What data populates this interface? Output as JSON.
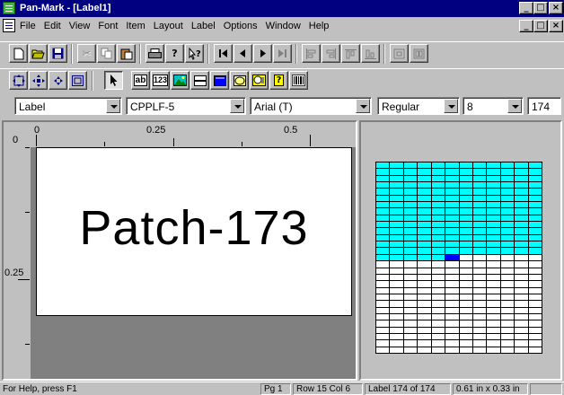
{
  "app": {
    "title": "Pan-Mark - [Label1]"
  },
  "window_controls": {
    "minimize": "_",
    "restore": "¸",
    "close": "×"
  },
  "menu": [
    "File",
    "Edit",
    "View",
    "Font",
    "Item",
    "Layout",
    "Label",
    "Options",
    "Window",
    "Help"
  ],
  "toolbar1": {
    "buttons": [
      "new-icon",
      "open-icon",
      "save-icon",
      "cut-icon",
      "copy-icon",
      "paste-icon",
      "print-icon",
      "help-icon",
      "context-help-icon",
      "first-icon",
      "prev-icon",
      "next-icon",
      "last-icon",
      "align-left-icon",
      "align-right-icon",
      "align-top-icon",
      "align-bottom-icon",
      "center-h-icon",
      "center-v-icon"
    ]
  },
  "toolbar2": {
    "buttons": [
      "move-icon",
      "center-both-icon",
      "center-small-icon",
      "frame-icon",
      "pointer-icon",
      "text-tool-icon",
      "counter-tool-icon",
      "image-tool-icon",
      "line-tool-icon",
      "box-tool-icon",
      "ellipse-tool-icon",
      "date-tool-icon",
      "help-tool-icon",
      "barcode-tool-icon"
    ],
    "text_tool_label": "ab",
    "counter_tool_label": "123"
  },
  "combos": {
    "object": "Label",
    "labelstock": "CPPLF-5",
    "font": "Arial (T)",
    "style": "Regular",
    "size": "8",
    "number": "174"
  },
  "rulers": {
    "top": [
      "0",
      "0.25",
      "0.5"
    ],
    "left": [
      "0",
      "0.25"
    ]
  },
  "label": {
    "text": "Patch-173"
  },
  "sheet": {
    "columns": 12,
    "rows": 29,
    "filled_cells": 173,
    "current_cell": 174,
    "filled_color": "#00ffff",
    "current_color": "#0000ff",
    "empty_color": "#ffffff"
  },
  "status": {
    "help": "For Help, press F1",
    "page": "Pg 1",
    "rowcol": "Row 15 Col 6",
    "labelcount": "Label 174 of 174",
    "size": "0.61 in x 0.33 in"
  }
}
